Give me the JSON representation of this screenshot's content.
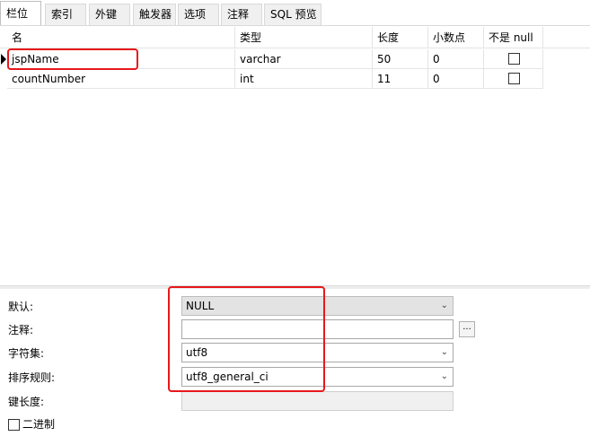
{
  "tabs": [
    "栏位",
    "索引",
    "外键",
    "触发器",
    "选项",
    "注释",
    "SQL 预览"
  ],
  "grid": {
    "columns": [
      "名",
      "类型",
      "长度",
      "小数点",
      "不是 null"
    ],
    "rows": [
      {
        "name": "jspName",
        "type": "varchar",
        "length": "50",
        "decimals": "0",
        "not_null": false
      },
      {
        "name": "countNumber",
        "type": "int",
        "length": "11",
        "decimals": "0",
        "not_null": false
      }
    ]
  },
  "properties": {
    "default_label": "默认:",
    "default_value": "NULL",
    "comment_label": "注释:",
    "comment_value": "",
    "comment_more": "...",
    "charset_label": "字符集:",
    "charset_value": "utf8",
    "collation_label": "排序规则:",
    "collation_value": "utf8_general_ci",
    "keylength_label": "键长度:",
    "keylength_value": "",
    "binary_label": "二进制"
  },
  "icons": {
    "dropdown": "chevron-down-icon",
    "row_pointer": "row-pointer-icon"
  },
  "colors": {
    "highlight": "#e8181b"
  }
}
